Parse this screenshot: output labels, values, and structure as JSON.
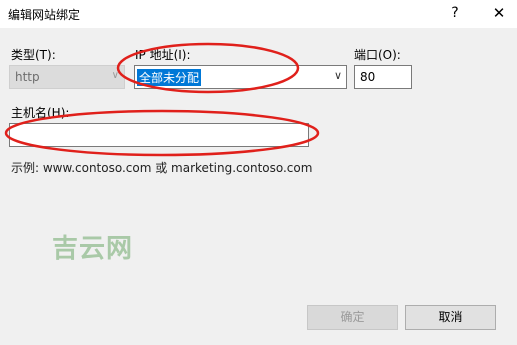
{
  "window": {
    "title": "编辑网站绑定",
    "help_label": "?",
    "close_label": "✕"
  },
  "fields": {
    "type": {
      "label": "类型(T):",
      "value": "http"
    },
    "ip": {
      "label": "IP 地址(I):",
      "value": "全部未分配"
    },
    "port": {
      "label": "端口(O):",
      "value": "80"
    },
    "host": {
      "label": "主机名(H):",
      "value": ""
    }
  },
  "example_text": "示例: www.contoso.com 或 marketing.contoso.com",
  "watermark": "吉云网",
  "buttons": {
    "ok": "确定",
    "cancel": "取消"
  },
  "colors": {
    "selection": "#0078d7",
    "annotation": "#e0201b",
    "watermark": "#9dc39b"
  },
  "icons": {
    "dropdown": "chevron-down-icon",
    "close": "close-icon",
    "help": "help-icon"
  }
}
